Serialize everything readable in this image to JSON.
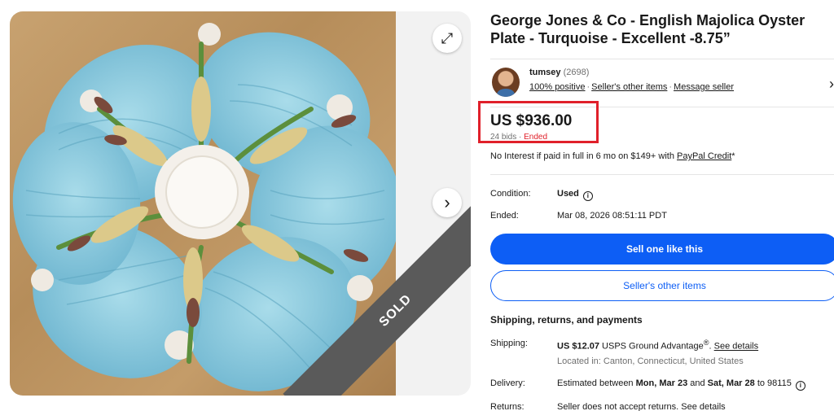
{
  "listing": {
    "title": "George Jones & Co - English Majolica Oyster Plate - Turquoise - Excellent -8.75”",
    "sold_label": "SOLD"
  },
  "gallery": {
    "expand_icon": "expand-icon",
    "next_icon": "chevron-right-icon"
  },
  "seller": {
    "name": "tumsey",
    "count": "(2698)",
    "positive": "100% positive",
    "other_items": "Seller's other items",
    "message": "Message seller"
  },
  "price": {
    "amount": "US $936.00",
    "bids": "24 bids",
    "separator": " · ",
    "status": "Ended",
    "financing_prefix": "No Interest if paid in full in 6 mo on $149+ with ",
    "financing_link": "PayPal Credit",
    "financing_suffix": "*"
  },
  "specs": {
    "condition_label": "Condition:",
    "condition_value": "Used",
    "ended_label": "Ended:",
    "ended_value": "Mar 08, 2026 08:51:11 PDT"
  },
  "actions": {
    "sell_label": "Sell one like this",
    "other_items_label": "Seller's other items"
  },
  "shipping": {
    "section_title": "Shipping, returns, and payments",
    "shipping_label": "Shipping:",
    "shipping_price": "US $12.07",
    "shipping_method": " USPS Ground Advantage",
    "shipping_reg": "®",
    "shipping_period": ". ",
    "see_details": "See details",
    "location": "Located in: Canton, Connecticut, United States",
    "delivery_label": "Delivery:",
    "delivery_prefix": "Estimated between ",
    "delivery_start": "Mon, Mar 23",
    "delivery_and": " and ",
    "delivery_end": "Sat, Mar 28",
    "delivery_suffix": " to 98115",
    "returns_label": "Returns:",
    "returns_value": "Seller does not accept returns. See details"
  },
  "colors": {
    "accent_blue": "#0d5ef5",
    "highlight_red": "#e0202a",
    "plate_turquoise": "#8fcde0"
  }
}
